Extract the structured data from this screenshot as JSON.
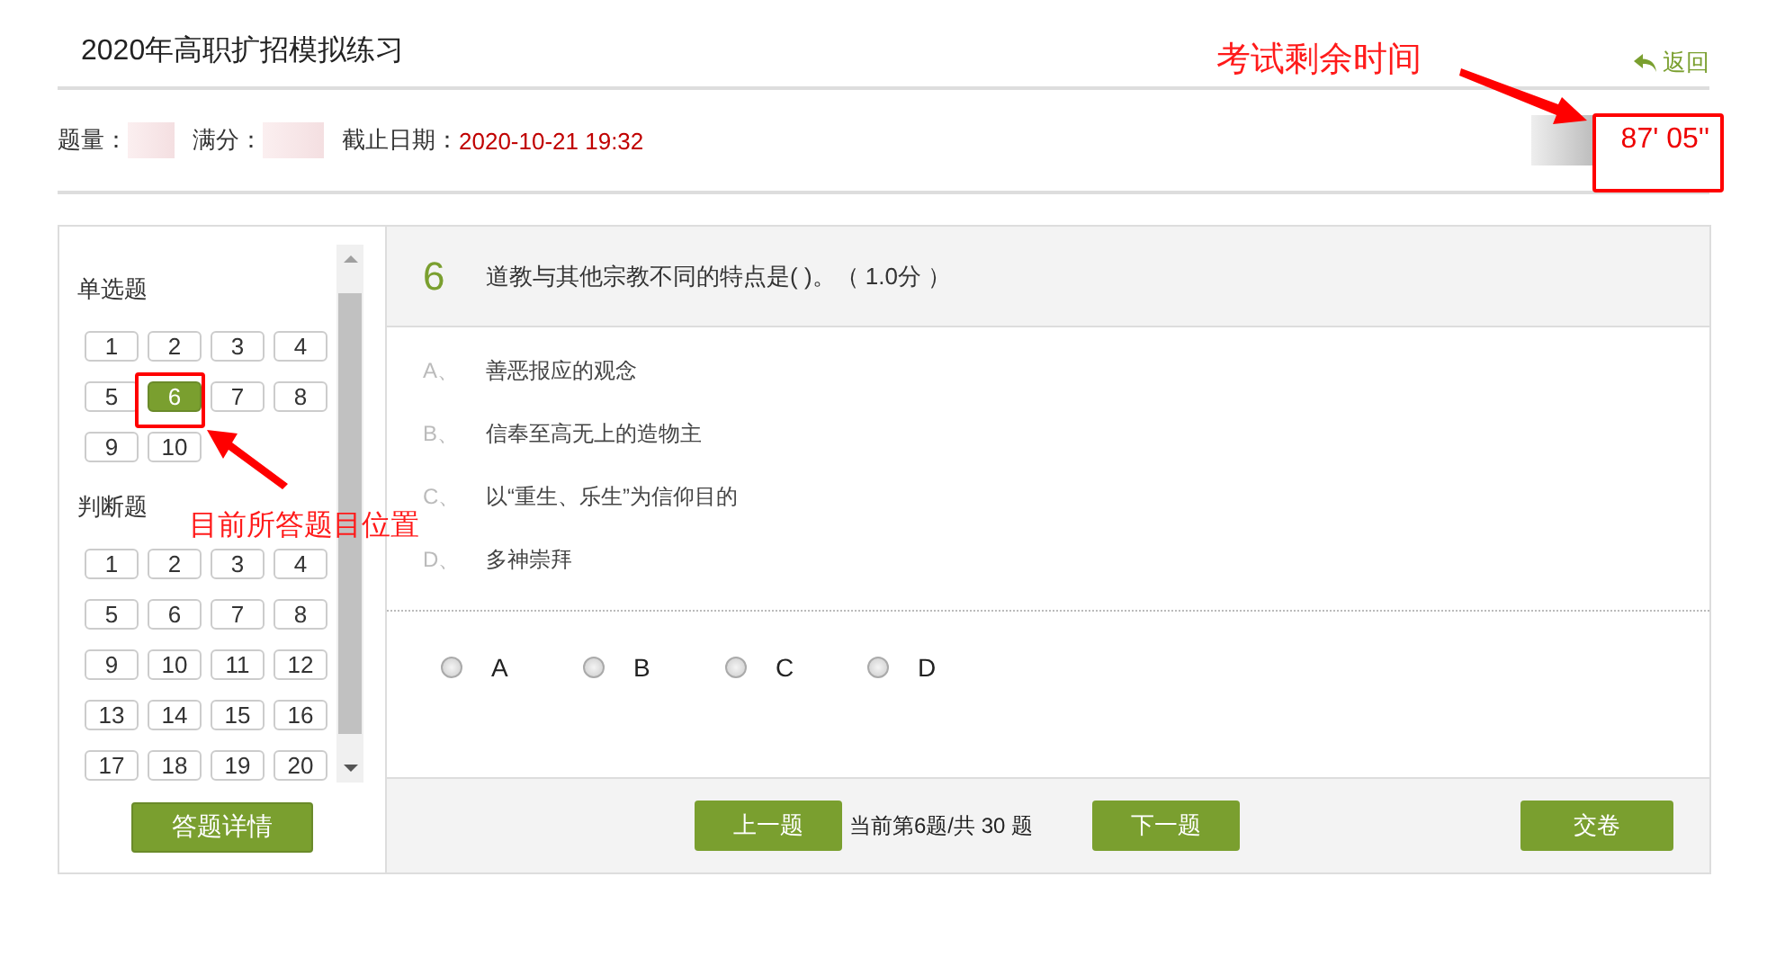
{
  "header": {
    "title": "2020年高职扩招模拟练习",
    "back_link": "返回"
  },
  "info": {
    "count_label": "题量：",
    "score_label": "满分：",
    "deadline_label": "截止日期：",
    "deadline": "2020-10-21 19:32",
    "timer": "87' 05''"
  },
  "sidebar": {
    "sections": [
      {
        "title": "单选题",
        "items": [
          {
            "label": "1",
            "selected": false
          },
          {
            "label": "2",
            "selected": false
          },
          {
            "label": "3",
            "selected": false
          },
          {
            "label": "4",
            "selected": false
          },
          {
            "label": "5",
            "selected": false
          },
          {
            "label": "6",
            "selected": true
          },
          {
            "label": "7",
            "selected": false
          },
          {
            "label": "8",
            "selected": false
          },
          {
            "label": "9",
            "selected": false
          },
          {
            "label": "10",
            "selected": false
          }
        ]
      },
      {
        "title": "判断题",
        "items": [
          {
            "label": "1",
            "selected": false
          },
          {
            "label": "2",
            "selected": false
          },
          {
            "label": "3",
            "selected": false
          },
          {
            "label": "4",
            "selected": false
          },
          {
            "label": "5",
            "selected": false
          },
          {
            "label": "6",
            "selected": false
          },
          {
            "label": "7",
            "selected": false
          },
          {
            "label": "8",
            "selected": false
          },
          {
            "label": "9",
            "selected": false
          },
          {
            "label": "10",
            "selected": false
          },
          {
            "label": "11",
            "selected": false
          },
          {
            "label": "12",
            "selected": false
          },
          {
            "label": "13",
            "selected": false
          },
          {
            "label": "14",
            "selected": false
          },
          {
            "label": "15",
            "selected": false
          },
          {
            "label": "16",
            "selected": false
          },
          {
            "label": "17",
            "selected": false
          },
          {
            "label": "18",
            "selected": false
          },
          {
            "label": "19",
            "selected": false
          },
          {
            "label": "20",
            "selected": false
          }
        ]
      }
    ],
    "detail_button": "答题详情"
  },
  "question": {
    "number": "6",
    "text": "道教与其他宗教不同的特点是( )。（ 1.0分 ）",
    "options": [
      {
        "letter": "A、",
        "text": "善恶报应的观念"
      },
      {
        "letter": "B、",
        "text": "信奉至高无上的造物主"
      },
      {
        "letter": "C、",
        "text": "以“重生、乐生”为信仰目的"
      },
      {
        "letter": "D、",
        "text": "多神崇拜"
      }
    ],
    "answers": [
      {
        "label": "A",
        "selected": false
      },
      {
        "label": "B",
        "selected": false
      },
      {
        "label": "C",
        "selected": false
      },
      {
        "label": "D",
        "selected": false
      }
    ],
    "prev_button": "上一题",
    "progress": "当前第6题/共 30 题",
    "next_button": "下一题",
    "submit_button": "交卷"
  },
  "annotations": [
    {
      "text": "考试剩余时间"
    },
    {
      "text": "目前所答题目位置"
    }
  ]
}
